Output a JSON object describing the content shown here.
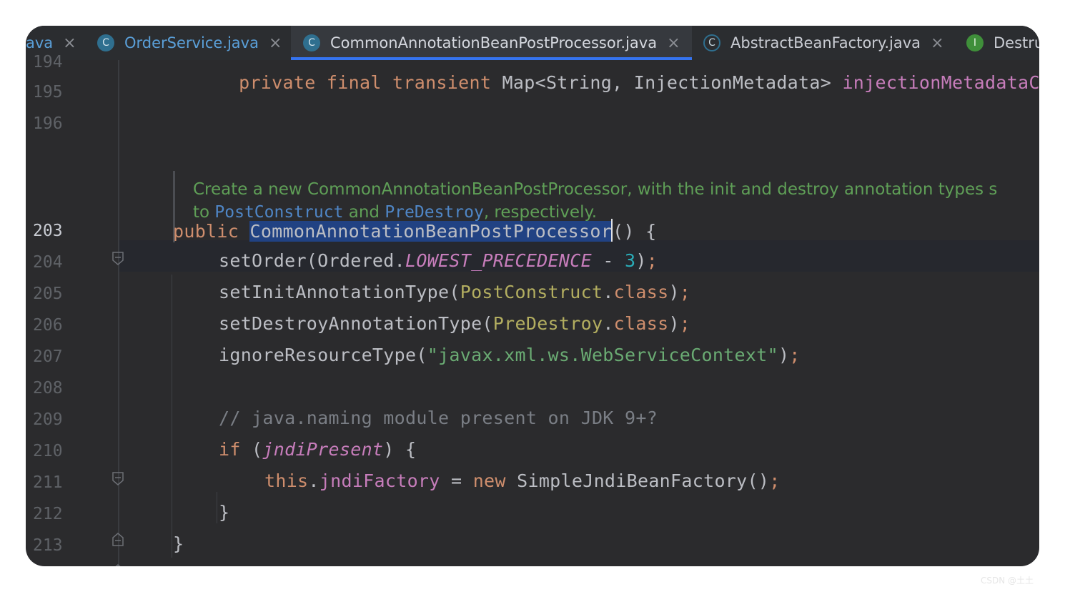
{
  "tabs": [
    {
      "label": "ava",
      "icon": "none",
      "active": false
    },
    {
      "label": "OrderService.java",
      "icon": "class",
      "icon_glyph": "C",
      "active": false
    },
    {
      "label": "CommonAnnotationBeanPostProcessor.java",
      "icon": "class",
      "icon_glyph": "C",
      "active": true
    },
    {
      "label": "AbstractBeanFactory.java",
      "icon": "abstract-class",
      "icon_glyph": "C",
      "active": false
    },
    {
      "label": "Destru",
      "icon": "interface",
      "icon_glyph": "I",
      "active": false
    }
  ],
  "close_glyph": "×",
  "line_numbers": {
    "l194": "194",
    "l195": "195",
    "l196": "196",
    "l203": "203",
    "l204": "204",
    "l205": "205",
    "l206": "206",
    "l207": "207",
    "l208": "208",
    "l209": "209",
    "l210": "210",
    "l211": "211",
    "l212": "212",
    "l213": "213"
  },
  "code": {
    "l194": {
      "t1": "private final transient ",
      "t2": "Map<String, InjectionMetadata> ",
      "t3": "injectionMetadataCach"
    },
    "doc": {
      "p1": "Create a new CommonAnnotationBeanPostProcessor, with the init and destroy annotation types s",
      "p2": "to ",
      "link1": "PostConstruct",
      "p3": " and ",
      "link2": "PreDestroy",
      "p4": ", respectively."
    },
    "l203": {
      "kw": "public ",
      "name": "CommonAnnotationBeanPostProcessor",
      "rest": "() {"
    },
    "l204": {
      "a": "setOrder(Ordered.",
      "b": "LOWEST_PRECEDENCE",
      "c": " - ",
      "d": "3",
      "e": ")",
      "f": ";"
    },
    "l205": {
      "a": "setInitAnnotationType(",
      "b": "PostConstruct",
      "c": ".",
      "d": "class",
      "e": ")",
      "f": ";"
    },
    "l206": {
      "a": "setDestroyAnnotationType(",
      "b": "PreDestroy",
      "c": ".",
      "d": "class",
      "e": ")",
      "f": ";"
    },
    "l207": {
      "a": "ignoreResourceType(",
      "b": "\"javax.xml.ws.WebServiceContext\"",
      "c": ")",
      "d": ";"
    },
    "l209": {
      "a": "// java.naming module present on JDK 9+?"
    },
    "l210": {
      "a": "if",
      "b": " (",
      "c": "jndiPresent",
      "d": ") {"
    },
    "l211": {
      "a": "this",
      "b": ".",
      "c": "jndiFactory",
      "d": " = ",
      "e": "new",
      "f": " SimpleJndiBeanFactory()",
      "g": ";"
    },
    "l212": {
      "a": "}"
    },
    "l213": {
      "a": "}"
    }
  },
  "watermark": "CSDN @土土"
}
